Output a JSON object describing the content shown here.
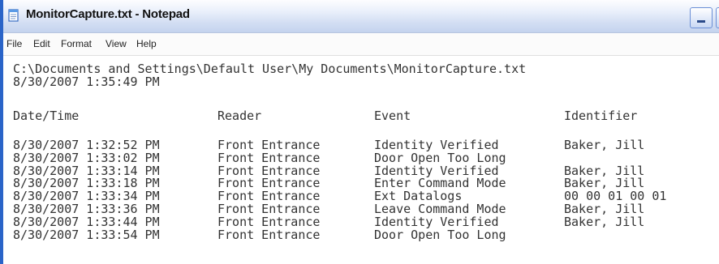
{
  "window": {
    "title": "MonitorCapture.txt - Notepad"
  },
  "icons": {
    "app": "notepad-icon",
    "minimize": "minimize-icon",
    "maximize": "maximize-icon"
  },
  "menu": {
    "file": "File",
    "edit": "Edit",
    "format": "Format",
    "view": "View",
    "help": "Help"
  },
  "document": {
    "path_line": "C:\\Documents and Settings\\Default User\\My Documents\\MonitorCapture.txt",
    "timestamp_line": "8/30/2007 1:35:49 PM",
    "headers": {
      "datetime": "Date/Time",
      "reader": "Reader",
      "event": "Event",
      "identifier": "Identifier"
    },
    "rows": [
      {
        "datetime": "8/30/2007 1:32:52 PM",
        "reader": "Front Entrance",
        "event": "Identity Verified",
        "identifier": "Baker, Jill"
      },
      {
        "datetime": "8/30/2007 1:33:02 PM",
        "reader": "Front Entrance",
        "event": "Door Open Too Long",
        "identifier": ""
      },
      {
        "datetime": "8/30/2007 1:33:14 PM",
        "reader": "Front Entrance",
        "event": "Identity Verified",
        "identifier": "Baker, Jill"
      },
      {
        "datetime": "8/30/2007 1:33:18 PM",
        "reader": "Front Entrance",
        "event": "Enter Command Mode",
        "identifier": "Baker, Jill"
      },
      {
        "datetime": "8/30/2007 1:33:34 PM",
        "reader": "Front Entrance",
        "event": "Ext Datalogs",
        "identifier": "00 00 01 00 01"
      },
      {
        "datetime": "8/30/2007 1:33:36 PM",
        "reader": "Front Entrance",
        "event": "Leave Command Mode",
        "identifier": "Baker, Jill"
      },
      {
        "datetime": "8/30/2007 1:33:44 PM",
        "reader": "Front Entrance",
        "event": "Identity Verified",
        "identifier": "Baker, Jill"
      },
      {
        "datetime": "8/30/2007 1:33:54 PM",
        "reader": "Front Entrance",
        "event": "Door Open Too Long",
        "identifier": ""
      }
    ]
  }
}
